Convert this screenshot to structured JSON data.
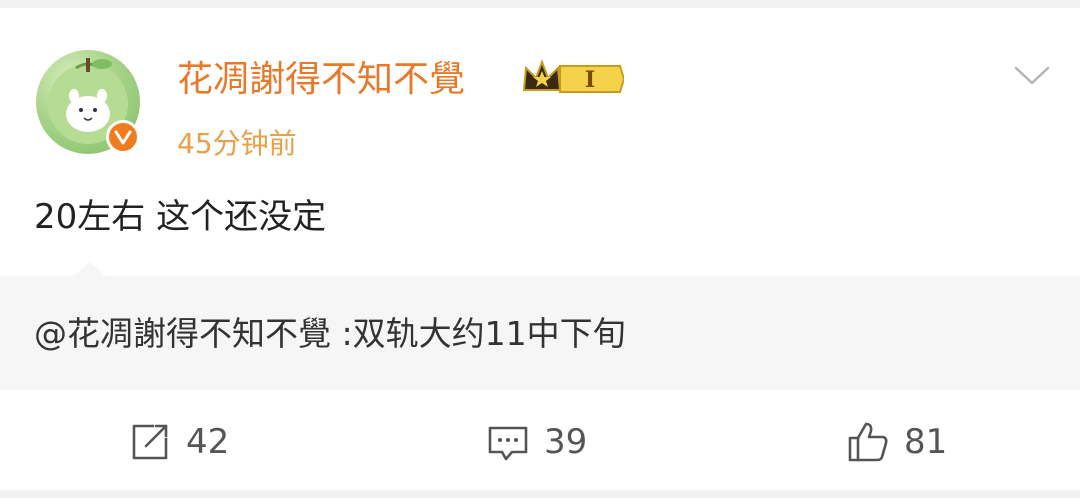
{
  "post": {
    "author": {
      "name": "花凋謝得不知不覺",
      "timestamp": "45分钟前",
      "vip_level": "I",
      "avatar_icon": "apple-cat-avatar",
      "verified_icon": "verified-v-icon"
    },
    "text": "20左右 这个还没定",
    "repost": {
      "mention": "@花凋謝得不知不覺",
      "text": " :双轨大约11中下旬"
    },
    "actions": {
      "repost_count": "42",
      "comment_count": "39",
      "like_count": "81"
    }
  },
  "colors": {
    "username": "#e8782a",
    "timestamp": "#e8a04a",
    "verified": "#f07c1e",
    "repost_bg": "#f6f6f6"
  }
}
